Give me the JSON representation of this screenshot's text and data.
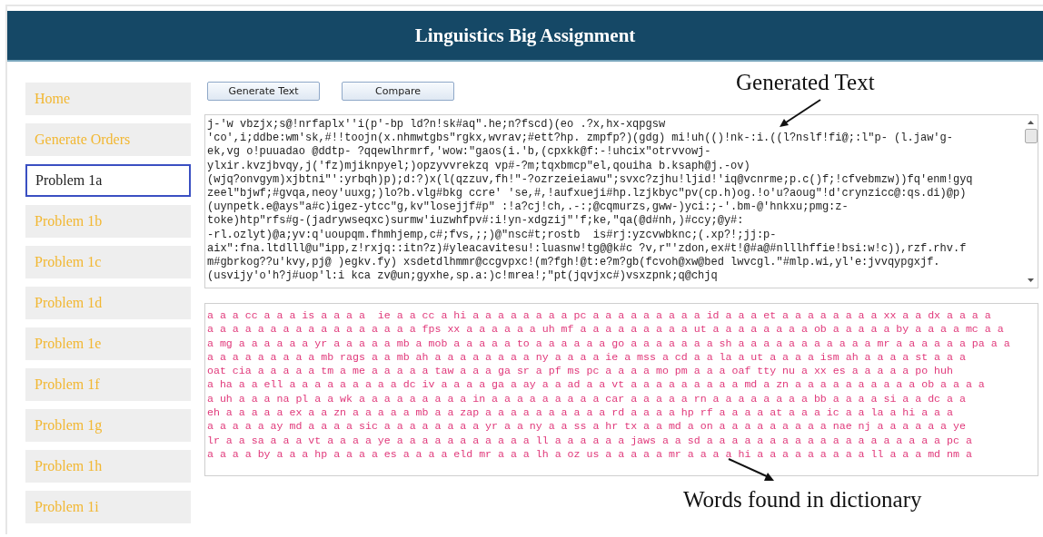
{
  "window": {
    "title": "Linguistics Big Assignment"
  },
  "sidebar": {
    "items": [
      {
        "label": "Home",
        "selected": false
      },
      {
        "label": "Generate Orders",
        "selected": false
      },
      {
        "label": "Problem 1a",
        "selected": true
      },
      {
        "label": "Problem 1b",
        "selected": false
      },
      {
        "label": "Problem 1c",
        "selected": false
      },
      {
        "label": "Problem 1d",
        "selected": false
      },
      {
        "label": "Problem 1e",
        "selected": false
      },
      {
        "label": "Problem 1f",
        "selected": false
      },
      {
        "label": "Problem 1g",
        "selected": false
      },
      {
        "label": "Problem 1h",
        "selected": false
      },
      {
        "label": "Problem 1i",
        "selected": false
      }
    ]
  },
  "buttons": [
    "Generate Text",
    "Compare"
  ],
  "generated_text": {
    "lines": [
      "j-'w vbzjx;s@!nrfaplx''i(p'-bp ld?n!sk#aq\".he;n?fscd)(eo .?x,hx-xqpgsw",
      "'co',i;ddbe:wm'sk,#!!toojn(x.nhmwtgbs\"rgkx,wvrav;#ett?hp. zmpfp?)(gdg) mi!uh(()!nk-:i.((l?nslf!fi@;:l\"p- (l.jaw'g-",
      "ek,vg o!puuadao @ddtp- ?qqewlhrmrf,'wow:\"gaos(i.'b,(cpxkk@f:-!uhcix\"otrvvowj-",
      "ylxir.kvzjbvqy,j('fz)mjiknpyel;)opzyvvrekzq vp#-?m;tqxbmcp\"el,qouiha b.ksaph@j.-ov)",
      "(wjq?onvgym)xjbtni\"':yrbqh)p);d:?)x(l(qzzuv,fh!\"-?ozrzeieiawu\";svxc?zjhu!ljid!'iq@vcnrme;p.c()f;!cfvebmzw))fq'enm!gyq",
      "zeel\"bjwf;#gvqa,neoy'uuxg;)lo?b.vlg#bkg ccre' 'se,#,!aufxueji#hp.lzjkbyc\"pv(cp.h)og.!o'u?aoug\"!d'crynzicc@:qs.di)@p)",
      "(uynpetk.e@ays\"a#c)igez-ytcc\"g,kv\"losejjf#p\" :!a?cj!ch,.-:;@cqmurzs,gww-)yci:;-'.bm-@'hnkxu;pmg:z-",
      "toke)htp\"rfs#g-(jadrywseqxc)surmw'iuzwhfpv#:i!yn-xdgzij\"'f;ke,\"qa(@d#nh,)#ccy;@y#:",
      "-rl.ozlyt)@a;yv:q'uoupqm.fhmhjemp,c#;fvs,;;)@\"nsc#t;rostb  is#rj:yzcvwbknc;(.xp?!;jj:p-",
      "aix\":fna.ltdlll@u\"ipp,z!rxjq::itn?z)#yleacavitesu!:luasnw!tg@@k#c ?v,r\"'zdon,ex#t!@#a@#nlllhffie!bsi:w!c)),rzf.rhv.f",
      "m#gbrkog??u'kvy,pj@ )egkv.fy) xsdetdlhmmr@ccgvpxc!(m?fgh!@t:e?m?gb(fcvoh@xw@bed lwvcgl.\"#mlp.wi,yl'e:jvvqypgxjf.",
      "(usvijy'o'h?j#uop'l:i kca zv@un;gyxhe,sp.a:)c!mrea!;\"pt(jqvjxc#)vsxzpnk;q@chjq"
    ]
  },
  "dictionary_words": {
    "lines": [
      "a a a cc a a a is a a a a  ie a a cc a hi a a a a a a a a pc a a a a a a a a a id a a a et a a a a a a a a xx a a dx a a a a",
      "a a a a a a a a a a a a a a a a a fps xx a a a a a a uh mf a a a a a a a a a ut a a a a a a a a ob a a a a a by a a a a mc a a",
      "a mg a a a a a a yr a a a a a mb a mob a a a a a to a a a a a a go a a a a a a a sh a a a a a a a a a a a mr a a a a a a pa a a",
      "a a a a a a a a a mb rags a a mb ah a a a a a a a a ny a a a a ie a mss a cd a a la a ut a a a a ism ah a a a a st a a a",
      "oat cia a a a a a tm a me a a a a a taw a a a ga sr a pf ms pc a a a a mo pm a a a oaf tty nu a xx es a a a a a po huh",
      "a ha a a ell a a a a a a a a a dc iv a a a a ga a ay a a ad a a vt a a a a a a a a a md a zn a a a a a a a a a a ob a a a a",
      "a uh a a a na pl a a wk a a a a a a a a a in a a a a a a a a a car a a a a a rn a a a a a a a a bb a a a a si a a dc a a",
      "eh a a a a a ex a a zn a a a a a mb a a zap a a a a a a a a a a rd a a a a hp rf a a a a at a a a ic a a la a hi a a a",
      "a a a a a ay md a a a a sic a a a a a a a a yr a a ny a a ss a hr tx a a md a on a a a a a a a a a nae nj a a a a a a ye",
      "lr a a sa a a a vt a a a a ye a a a a a a a a a a a ll a a a a a a jaws a a sd a a a a a a a a a a a a a a a a a a a pc a",
      "a a a a by a a a hp a a a a es a a a a eld mr a a a lh a oz us a a a a a mr a a a a hi a a a a a a a a a ll a a a md nm a"
    ]
  },
  "annotations": [
    "Generated Text",
    "Words found in dictionary"
  ]
}
